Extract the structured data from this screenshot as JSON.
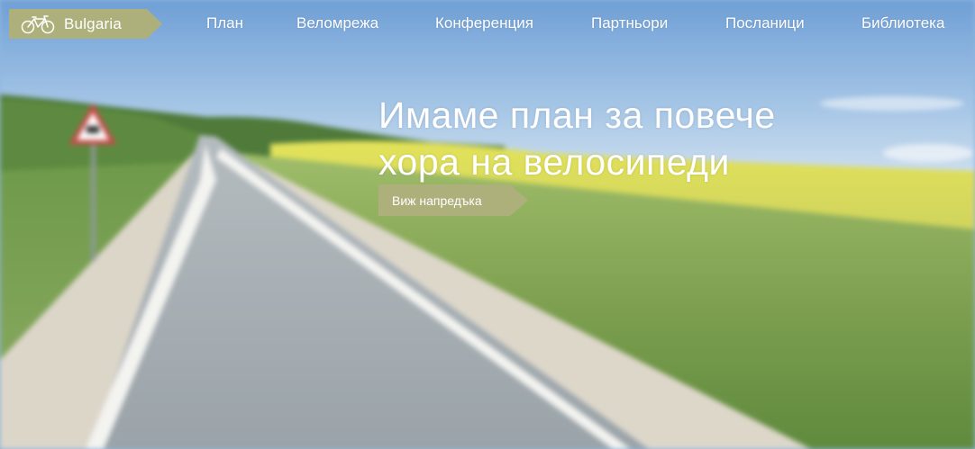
{
  "nav": {
    "brand_label": "Bulgaria",
    "brand_icon": "bicycle-icon",
    "items": [
      {
        "label": "План"
      },
      {
        "label": "Веломрежа"
      },
      {
        "label": "Конференция"
      },
      {
        "label": "Партньори"
      },
      {
        "label": "Посланици"
      },
      {
        "label": "Библиотека"
      }
    ]
  },
  "hero": {
    "headline_line1": "Имаме план за повече",
    "headline_line2": "хора на велосипеди",
    "cta_label": "Виж напредъка",
    "background": "blurred road through green and yellow rapeseed fields",
    "accent_color": "#aeb07c"
  }
}
